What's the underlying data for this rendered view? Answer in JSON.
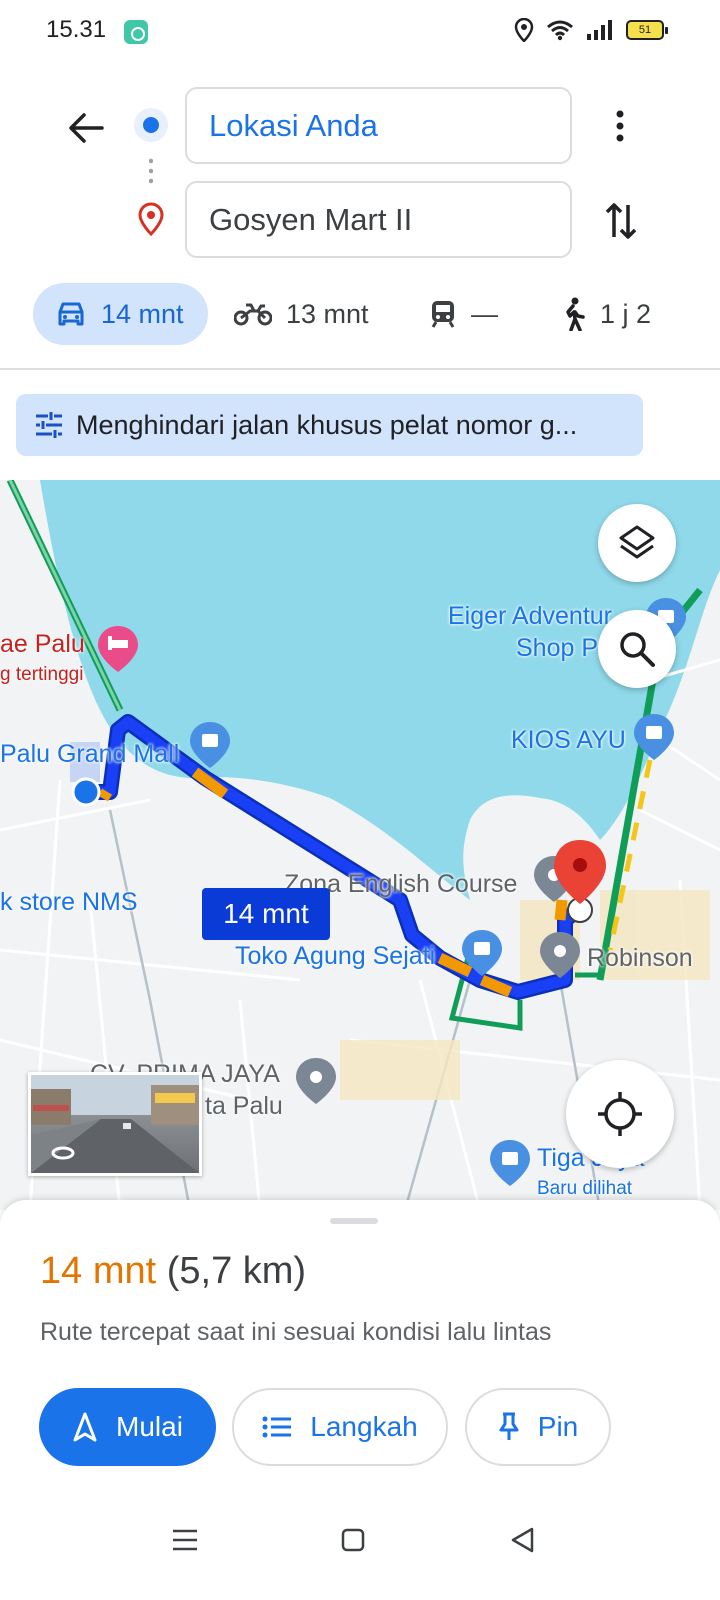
{
  "status_bar": {
    "time": "15.31",
    "battery": "51",
    "icons": [
      "app-notification-icon",
      "location-icon",
      "wifi-icon",
      "signal-icon",
      "battery-icon"
    ]
  },
  "directions": {
    "origin": "Lokasi Anda",
    "destination": "Gosyen Mart II",
    "icons": [
      "back-arrow-icon",
      "origin-dot-icon",
      "destination-pin-icon",
      "more-vert-icon",
      "swap-icon"
    ]
  },
  "modes": [
    {
      "name": "car",
      "label": "14 mnt",
      "selected": true,
      "icon": "car-icon"
    },
    {
      "name": "motorcycle",
      "label": "13 mnt",
      "icon": "motorcycle-icon"
    },
    {
      "name": "transit",
      "label": "—",
      "icon": "train-icon"
    },
    {
      "name": "walk",
      "label": "1 j 2",
      "icon": "walk-icon"
    }
  ],
  "avoid_chip": {
    "label": "Menghindari jalan khusus pelat nomor g...",
    "icon": "tune-icon"
  },
  "map": {
    "route_time": "14 mnt",
    "labels": {
      "hotel": "ae Palu",
      "hotel_sub": "g tertinggi",
      "mall": "Palu Grand Mall",
      "eiger_1": "Eiger Adventur",
      "eiger_2": "Shop P",
      "kios": "KIOS AYU",
      "store": "k store NMS",
      "zona": "Zona English Course",
      "toko": "Toko Agung Sejati",
      "robinson": "Robinson",
      "prima": "CV. PRIMA JAYA",
      "prima_sub": "ta Palu",
      "tiga": "Tiga Jaya",
      "recent": "Baru dilihat"
    },
    "colors": {
      "water": "#8fd9ea",
      "route": "#1a40f5",
      "traffic": "#f29900",
      "pin": "#ea4335"
    }
  },
  "sheet": {
    "duration": "14 mnt",
    "distance": "(5,7 km)",
    "subtitle": "Rute tercepat saat ini sesuai kondisi lalu lintas",
    "start_label": "Mulai",
    "steps_label": "Langkah",
    "pin_label": "Pin"
  }
}
